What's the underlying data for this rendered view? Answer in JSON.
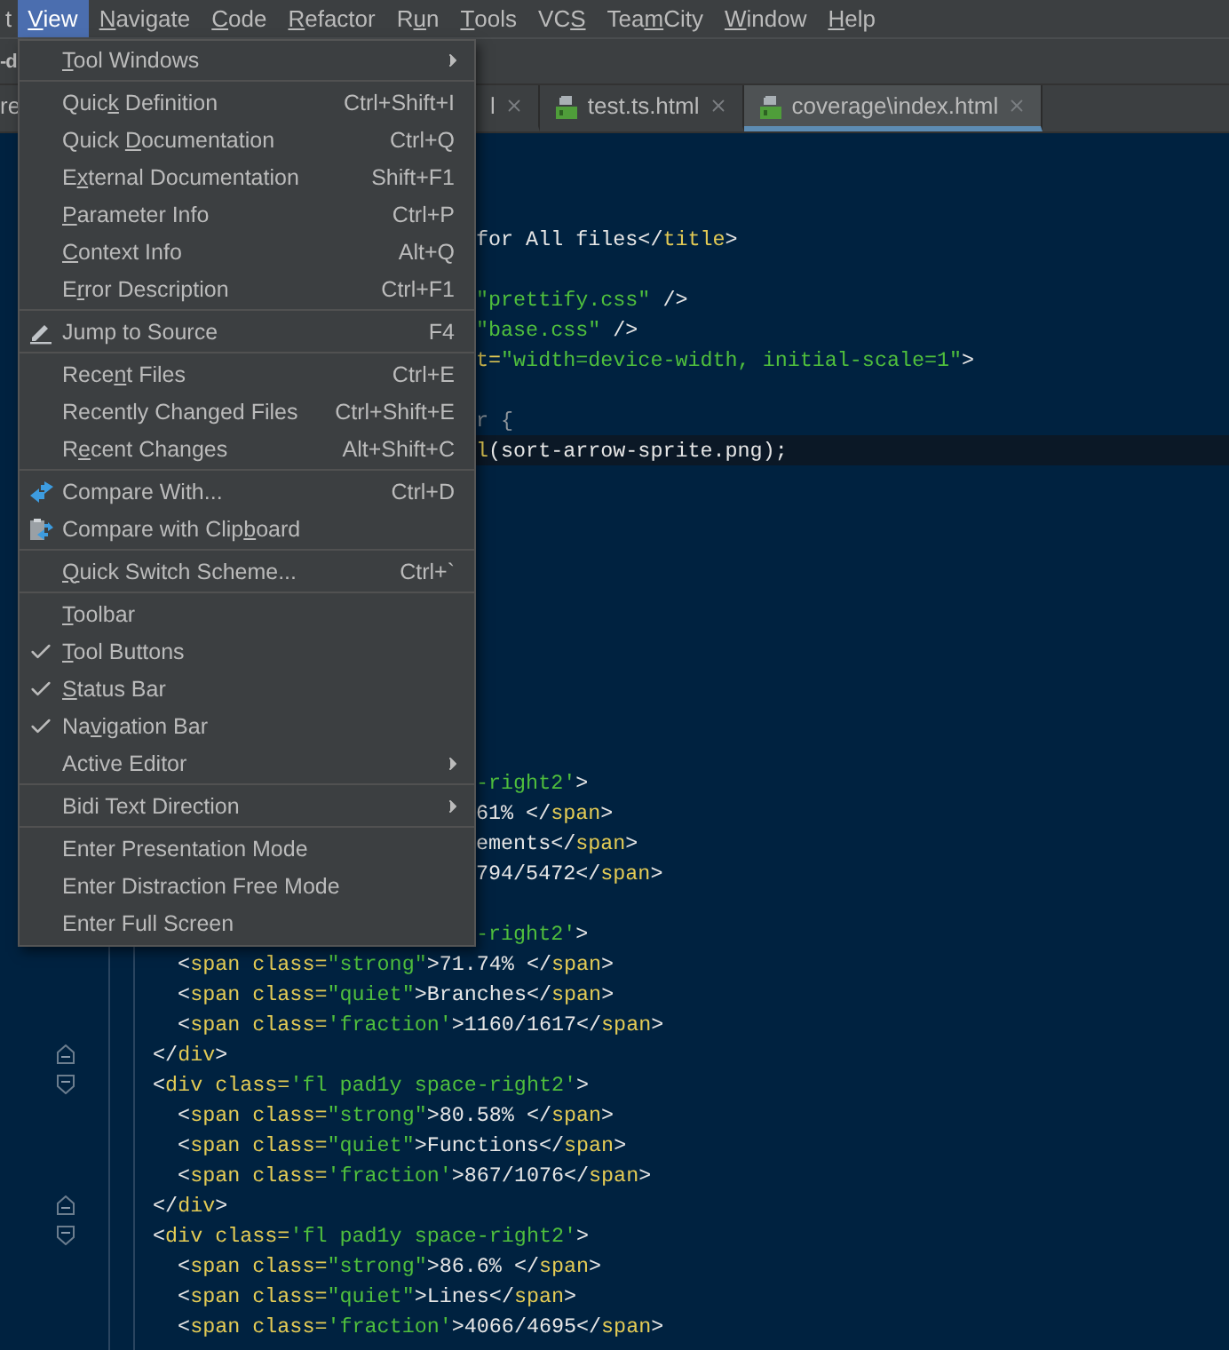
{
  "menu_bar": [
    {
      "label": {
        "pre": "t"
      },
      "selected": false
    },
    {
      "label": {
        "key": "V",
        "post": "iew"
      },
      "selected": true
    },
    {
      "label": {
        "key": "N",
        "post": "avigate"
      },
      "selected": false
    },
    {
      "label": {
        "key": "C",
        "post": "ode"
      },
      "selected": false
    },
    {
      "label": {
        "key": "R",
        "post": "efactor"
      },
      "selected": false
    },
    {
      "label": {
        "pre": "R",
        "key": "u",
        "post": "n"
      },
      "selected": false
    },
    {
      "label": {
        "key": "T",
        "post": "ools"
      },
      "selected": false
    },
    {
      "label": {
        "pre": "VC",
        "key": "S"
      },
      "selected": false
    },
    {
      "label": {
        "pre": "Tea",
        "key": "m",
        "post": "City"
      },
      "selected": false
    },
    {
      "label": {
        "key": "W",
        "post": "indow"
      },
      "selected": false
    },
    {
      "label": {
        "key": "H",
        "post": "elp"
      },
      "selected": false
    }
  ],
  "navigation_bar": {
    "text": "-d"
  },
  "tabs": [
    {
      "label": "re",
      "kind": "plain",
      "closable": false,
      "selected": false
    },
    {
      "label": "l",
      "kind": "plain",
      "closable": true,
      "selected": false
    },
    {
      "label": "test.ts.html",
      "kind": "html",
      "closable": true,
      "selected": false
    },
    {
      "label": "coverage\\index.html",
      "kind": "html",
      "closable": true,
      "selected": true
    }
  ],
  "view_menu": [
    {
      "kind": "submenu",
      "label": {
        "key": "T",
        "post": "ool Windows"
      }
    },
    {
      "kind": "separator"
    },
    {
      "kind": "plain",
      "label": {
        "pre": "Quic",
        "key": "k",
        "post": " Definition"
      },
      "shortcut": "Ctrl+Shift+I"
    },
    {
      "kind": "plain",
      "label": {
        "pre": "Quick ",
        "key": "D",
        "post": "ocumentation"
      },
      "shortcut": "Ctrl+Q"
    },
    {
      "kind": "plain",
      "label": {
        "pre": "E",
        "key": "x",
        "post": "ternal Documentation"
      },
      "shortcut": "Shift+F1"
    },
    {
      "kind": "plain",
      "label": {
        "key": "P",
        "post": "arameter Info"
      },
      "shortcut": "Ctrl+P"
    },
    {
      "kind": "plain",
      "label": {
        "key": "C",
        "post": "ontext Info"
      },
      "shortcut": "Alt+Q"
    },
    {
      "kind": "plain",
      "label": {
        "pre": "E",
        "key": "r",
        "post": "ror Description"
      },
      "shortcut": "Ctrl+F1"
    },
    {
      "kind": "separator"
    },
    {
      "kind": "edit-action",
      "label": {
        "pre": "Jump to Source"
      },
      "shortcut": "F4"
    },
    {
      "kind": "separator"
    },
    {
      "kind": "plain",
      "label": {
        "pre": "Rece",
        "key": "n",
        "post": "t Files"
      },
      "shortcut": "Ctrl+E"
    },
    {
      "kind": "plain",
      "label": {
        "pre": "Recently Changed Files"
      },
      "shortcut": "Ctrl+Shift+E"
    },
    {
      "kind": "plain",
      "label": {
        "pre": "R",
        "key": "e",
        "post": "cent Changes"
      },
      "shortcut": "Alt+Shift+C"
    },
    {
      "kind": "separator"
    },
    {
      "kind": "compare-action",
      "label": {
        "pre": "Compare With..."
      },
      "shortcut": "Ctrl+D"
    },
    {
      "kind": "clipboard-compare-action",
      "label": {
        "pre": "Compare with Clip",
        "key": "b",
        "post": "oard"
      }
    },
    {
      "kind": "separator"
    },
    {
      "kind": "plain",
      "label": {
        "key": "Q",
        "post": "uick Switch Scheme..."
      },
      "shortcut": "Ctrl+`"
    },
    {
      "kind": "separator"
    },
    {
      "kind": "check",
      "checked": false,
      "label": {
        "key": "T",
        "post": "oolbar"
      }
    },
    {
      "kind": "check",
      "checked": true,
      "label": {
        "key": "T",
        "post": "ool Buttons"
      }
    },
    {
      "kind": "check",
      "checked": true,
      "label": {
        "key": "S",
        "post": "tatus Bar"
      }
    },
    {
      "kind": "check",
      "checked": true,
      "label": {
        "pre": "Na",
        "key": "v",
        "post": "igation Bar"
      }
    },
    {
      "kind": "submenu",
      "label": {
        "pre": "Active Editor"
      }
    },
    {
      "kind": "separator"
    },
    {
      "kind": "submenu",
      "label": {
        "pre": "Bidi Text Direction"
      }
    },
    {
      "kind": "separator"
    },
    {
      "kind": "plain",
      "label": {
        "pre": "Enter Presentation Mode"
      }
    },
    {
      "kind": "plain",
      "label": {
        "pre": "Enter Distraction Free Mode"
      }
    },
    {
      "kind": "plain",
      "label": {
        "pre": "Enter Full Screen"
      }
    }
  ],
  "code_lines": [
    {
      "kind": "blank",
      "current": false
    },
    {
      "kind": "blank",
      "current": false
    },
    {
      "kind": "blank",
      "current": false
    },
    {
      "kind": "clipped",
      "current": false,
      "tokens": [
        {
          "kind": "text",
          "text": "for All files</"
        },
        {
          "kind": "tag",
          "text": "title"
        },
        {
          "kind": "text",
          "text": ">"
        }
      ]
    },
    {
      "kind": "blank",
      "current": false
    },
    {
      "kind": "clipped",
      "current": false,
      "tokens": [
        {
          "kind": "string",
          "text": "\"prettify.css\""
        },
        {
          "kind": "text",
          "text": " />"
        }
      ]
    },
    {
      "kind": "clipped",
      "current": false,
      "tokens": [
        {
          "kind": "string",
          "text": "\"base.css\""
        },
        {
          "kind": "text",
          "text": " />"
        }
      ]
    },
    {
      "kind": "clipped",
      "current": false,
      "tokens": [
        {
          "kind": "tag",
          "text": "t="
        },
        {
          "kind": "string",
          "text": "\"width=device-width, initial-scale=1\""
        },
        {
          "kind": "text",
          "text": ">"
        }
      ]
    },
    {
      "kind": "blank",
      "current": false
    },
    {
      "kind": "clipped",
      "current": false,
      "tokens": [
        {
          "kind": "dim",
          "text": "r {"
        }
      ]
    },
    {
      "kind": "clipped",
      "current": true,
      "tokens": [
        {
          "kind": "tag",
          "text": "l"
        },
        {
          "kind": "text",
          "text": "(sort-arrow-sprite.png);"
        }
      ]
    },
    {
      "kind": "blank",
      "current": false
    },
    {
      "kind": "blank",
      "current": false
    },
    {
      "kind": "blank",
      "current": false
    },
    {
      "kind": "blank",
      "current": false
    },
    {
      "kind": "blank",
      "current": false
    },
    {
      "kind": "blank",
      "current": false
    },
    {
      "kind": "blank",
      "current": false
    },
    {
      "kind": "blank",
      "current": false
    },
    {
      "kind": "blank",
      "current": false
    },
    {
      "kind": "blank",
      "current": false
    },
    {
      "kind": "clipped",
      "current": false,
      "tokens": [
        {
          "kind": "string",
          "text": "-right2'"
        },
        {
          "kind": "text",
          "text": ">"
        }
      ]
    },
    {
      "kind": "clipped",
      "current": false,
      "tokens": [
        {
          "kind": "text",
          "text": "61% </"
        },
        {
          "kind": "tag",
          "text": "span"
        },
        {
          "kind": "text",
          "text": ">"
        }
      ]
    },
    {
      "kind": "clipped",
      "current": false,
      "tokens": [
        {
          "kind": "text",
          "text": "ements</"
        },
        {
          "kind": "tag",
          "text": "span"
        },
        {
          "kind": "text",
          "text": ">"
        }
      ]
    },
    {
      "kind": "clipped",
      "current": false,
      "tokens": [
        {
          "kind": "text",
          "text": "794/5472</"
        },
        {
          "kind": "tag",
          "text": "span"
        },
        {
          "kind": "text",
          "text": ">"
        }
      ]
    },
    {
      "kind": "blank",
      "current": false
    },
    {
      "kind": "clipped",
      "current": false,
      "tokens": [
        {
          "kind": "string",
          "text": "-right2'"
        },
        {
          "kind": "text",
          "text": ">"
        }
      ]
    },
    {
      "kind": "full",
      "current": false,
      "tokens": [
        {
          "kind": "text",
          "text": "    <"
        },
        {
          "kind": "tag",
          "text": "span class="
        },
        {
          "kind": "string",
          "text": "\"strong\""
        },
        {
          "kind": "text",
          "text": ">71.74% </"
        },
        {
          "kind": "tag",
          "text": "span"
        },
        {
          "kind": "text",
          "text": ">"
        }
      ]
    },
    {
      "kind": "full",
      "current": false,
      "tokens": [
        {
          "kind": "text",
          "text": "    <"
        },
        {
          "kind": "tag",
          "text": "span class="
        },
        {
          "kind": "string",
          "text": "\"quiet\""
        },
        {
          "kind": "text",
          "text": ">Branches</"
        },
        {
          "kind": "tag",
          "text": "span"
        },
        {
          "kind": "text",
          "text": ">"
        }
      ]
    },
    {
      "kind": "full",
      "current": false,
      "tokens": [
        {
          "kind": "text",
          "text": "    <"
        },
        {
          "kind": "tag",
          "text": "span class="
        },
        {
          "kind": "string",
          "text": "'fraction'"
        },
        {
          "kind": "text",
          "text": ">1160/1617</"
        },
        {
          "kind": "tag",
          "text": "span"
        },
        {
          "kind": "text",
          "text": ">"
        }
      ]
    },
    {
      "kind": "fold-end",
      "current": false,
      "tokens": [
        {
          "kind": "text",
          "text": "  </"
        },
        {
          "kind": "tag",
          "text": "div"
        },
        {
          "kind": "text",
          "text": ">"
        }
      ]
    },
    {
      "kind": "fold-start",
      "current": false,
      "tokens": [
        {
          "kind": "text",
          "text": "  <"
        },
        {
          "kind": "tag",
          "text": "div class="
        },
        {
          "kind": "string",
          "text": "'fl pad1y space-right2'"
        },
        {
          "kind": "text",
          "text": ">"
        }
      ]
    },
    {
      "kind": "full",
      "current": false,
      "tokens": [
        {
          "kind": "text",
          "text": "    <"
        },
        {
          "kind": "tag",
          "text": "span class="
        },
        {
          "kind": "string",
          "text": "\"strong\""
        },
        {
          "kind": "text",
          "text": ">80.58% </"
        },
        {
          "kind": "tag",
          "text": "span"
        },
        {
          "kind": "text",
          "text": ">"
        }
      ]
    },
    {
      "kind": "full",
      "current": false,
      "tokens": [
        {
          "kind": "text",
          "text": "    <"
        },
        {
          "kind": "tag",
          "text": "span class="
        },
        {
          "kind": "string",
          "text": "\"quiet\""
        },
        {
          "kind": "text",
          "text": ">Functions</"
        },
        {
          "kind": "tag",
          "text": "span"
        },
        {
          "kind": "text",
          "text": ">"
        }
      ]
    },
    {
      "kind": "full",
      "current": false,
      "tokens": [
        {
          "kind": "text",
          "text": "    <"
        },
        {
          "kind": "tag",
          "text": "span class="
        },
        {
          "kind": "string",
          "text": "'fraction'"
        },
        {
          "kind": "text",
          "text": ">867/1076</"
        },
        {
          "kind": "tag",
          "text": "span"
        },
        {
          "kind": "text",
          "text": ">"
        }
      ]
    },
    {
      "kind": "fold-end",
      "current": false,
      "tokens": [
        {
          "kind": "text",
          "text": "  </"
        },
        {
          "kind": "tag",
          "text": "div"
        },
        {
          "kind": "text",
          "text": ">"
        }
      ]
    },
    {
      "kind": "fold-start",
      "current": false,
      "tokens": [
        {
          "kind": "text",
          "text": "  <"
        },
        {
          "kind": "tag",
          "text": "div class="
        },
        {
          "kind": "string",
          "text": "'fl pad1y space-right2'"
        },
        {
          "kind": "text",
          "text": ">"
        }
      ]
    },
    {
      "kind": "full",
      "current": false,
      "tokens": [
        {
          "kind": "text",
          "text": "    <"
        },
        {
          "kind": "tag",
          "text": "span class="
        },
        {
          "kind": "string",
          "text": "\"strong\""
        },
        {
          "kind": "text",
          "text": ">86.6% </"
        },
        {
          "kind": "tag",
          "text": "span"
        },
        {
          "kind": "text",
          "text": ">"
        }
      ]
    },
    {
      "kind": "full",
      "current": false,
      "tokens": [
        {
          "kind": "text",
          "text": "    <"
        },
        {
          "kind": "tag",
          "text": "span class="
        },
        {
          "kind": "string",
          "text": "\"quiet\""
        },
        {
          "kind": "text",
          "text": ">Lines</"
        },
        {
          "kind": "tag",
          "text": "span"
        },
        {
          "kind": "text",
          "text": ">"
        }
      ]
    },
    {
      "kind": "full",
      "current": false,
      "tokens": [
        {
          "kind": "text",
          "text": "    <"
        },
        {
          "kind": "tag",
          "text": "span class="
        },
        {
          "kind": "string",
          "text": "'fraction'"
        },
        {
          "kind": "text",
          "text": ">4066/4695</"
        },
        {
          "kind": "tag",
          "text": "span"
        },
        {
          "kind": "text",
          "text": ">"
        }
      ]
    }
  ]
}
